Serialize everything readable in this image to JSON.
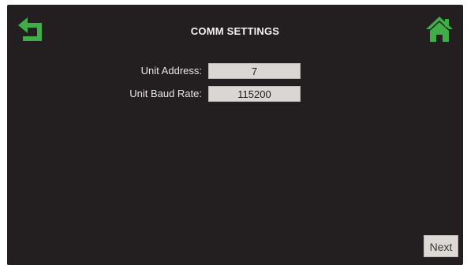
{
  "header": {
    "title": "COMM SETTINGS",
    "back_icon": "back-arrow-icon",
    "home_icon": "home-icon",
    "icon_color": "#3fae49"
  },
  "form": {
    "unit_address": {
      "label": "Unit Address:",
      "value": "7"
    },
    "unit_baud_rate": {
      "label": "Unit Baud Rate:",
      "value": "115200"
    }
  },
  "footer": {
    "next_label": "Next"
  },
  "colors": {
    "screen_background": "#231f20",
    "field_background": "#d9d6d3",
    "text": "#e6e6e6"
  }
}
